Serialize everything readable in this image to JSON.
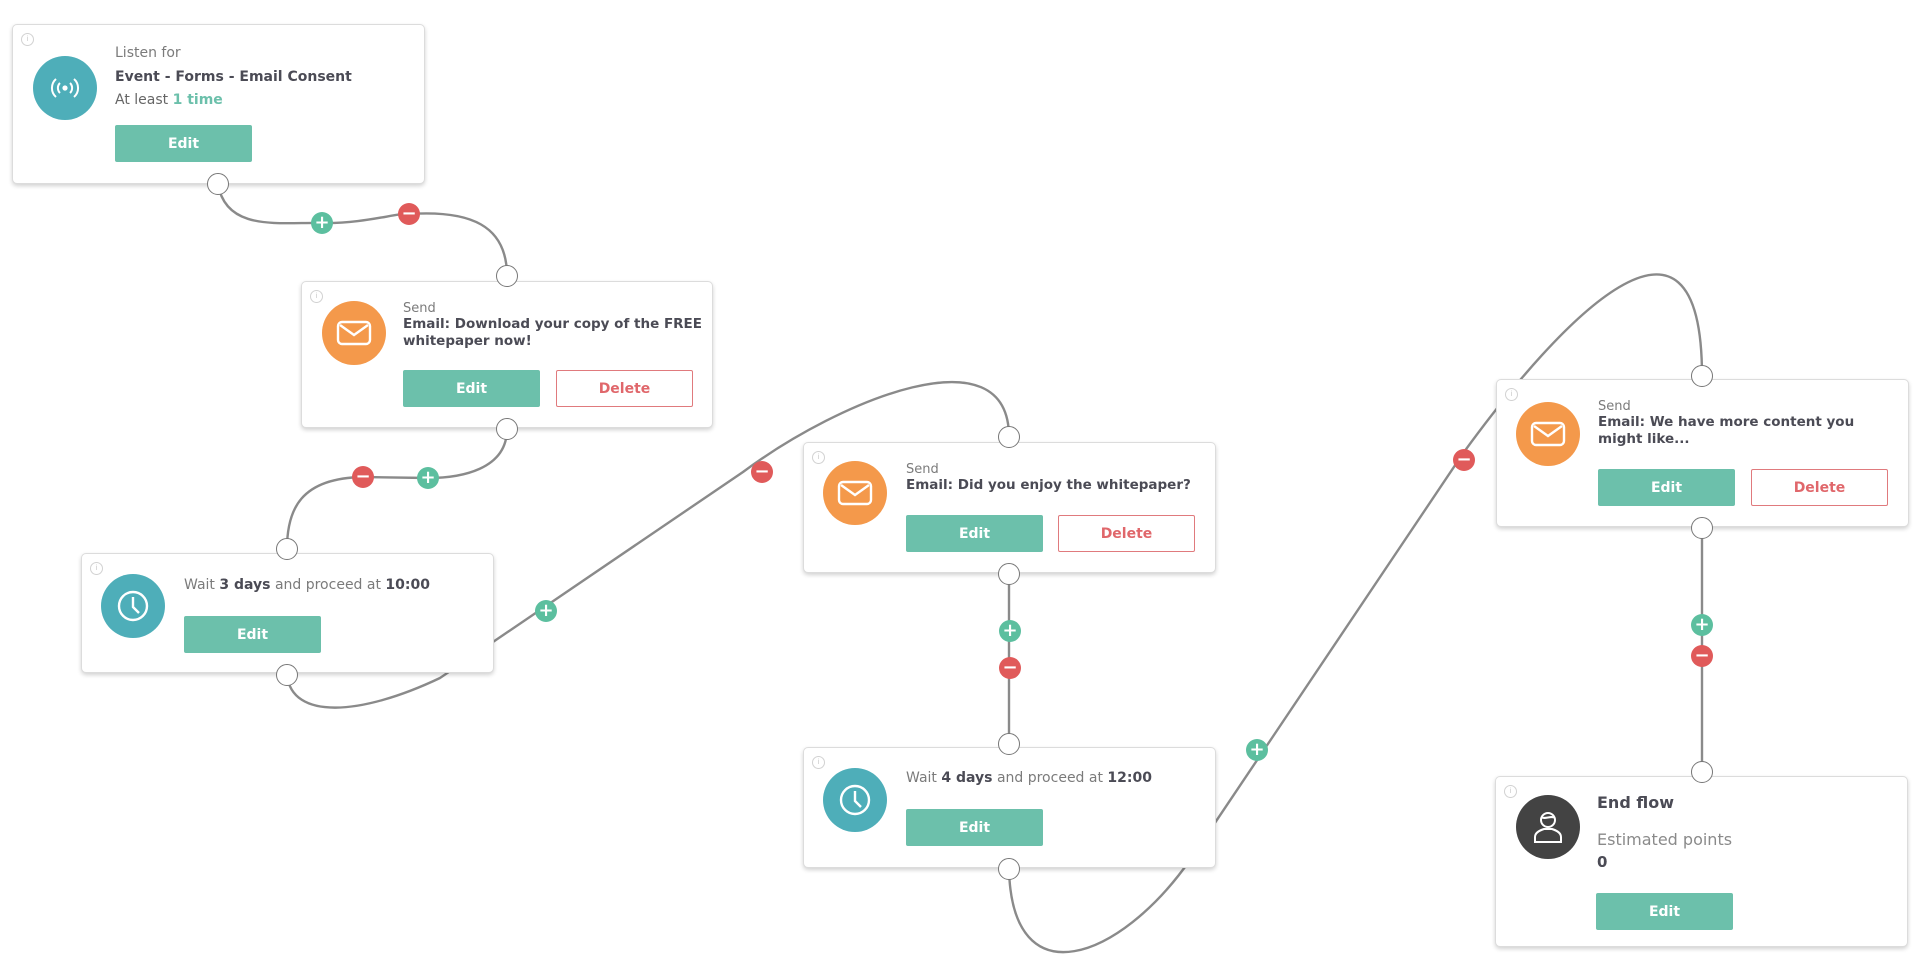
{
  "colors": {
    "accent": "#6cc0ab",
    "add": "#5cbf9f",
    "remove": "#e05a5a",
    "delete_border": "#e07a7d",
    "teal_icon": "#4eaeb9",
    "orange_icon": "#f4994b",
    "end_icon": "#434343"
  },
  "nodes": [
    {
      "type": "listen",
      "icon": "broadcast-icon",
      "label": "Listen for",
      "title": "Event - Forms - Email Consent",
      "frequency_prefix": "At least",
      "frequency_value": "1 time",
      "edit_label": "Edit"
    },
    {
      "type": "send",
      "icon": "envelope-icon",
      "label": "Send",
      "title": "Email: Download your copy of the FREE whitepaper now!",
      "edit_label": "Edit",
      "delete_label": "Delete"
    },
    {
      "type": "wait",
      "icon": "clock-icon",
      "prefix": "Wait",
      "duration": "3 days",
      "middle": "and proceed at",
      "time": "10:00",
      "edit_label": "Edit"
    },
    {
      "type": "send",
      "icon": "envelope-icon",
      "label": "Send",
      "title": "Email: Did you enjoy the whitepaper?",
      "edit_label": "Edit",
      "delete_label": "Delete"
    },
    {
      "type": "wait",
      "icon": "clock-icon",
      "prefix": "Wait",
      "duration": "4 days",
      "middle": "and proceed at",
      "time": "12:00",
      "edit_label": "Edit"
    },
    {
      "type": "send",
      "icon": "envelope-icon",
      "label": "Send",
      "title": "Email: We have more content you might like...",
      "edit_label": "Edit",
      "delete_label": "Delete"
    },
    {
      "type": "end",
      "icon": "user-icon",
      "title": "End flow",
      "points_label": "Estimated points",
      "points_value": "0",
      "edit_label": "Edit"
    }
  ],
  "controls": {
    "add_symbol": "+",
    "remove_symbol": "−",
    "info_symbol": "i"
  }
}
